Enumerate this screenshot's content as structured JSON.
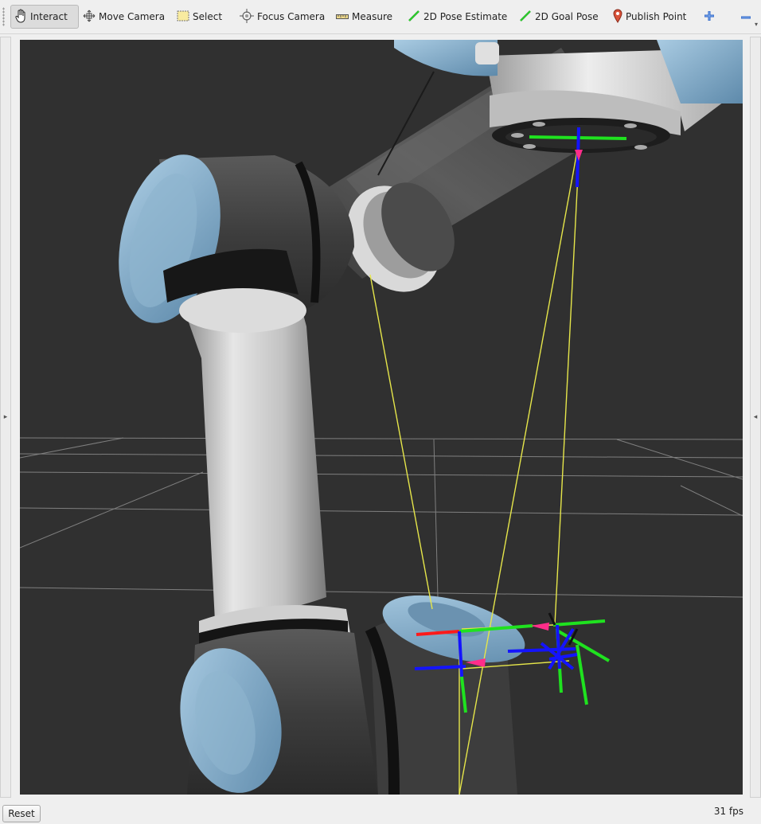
{
  "toolbar": {
    "tools": [
      {
        "label": "Interact",
        "icon": "hand-icon"
      },
      {
        "label": "Move Camera",
        "icon": "move-camera-icon"
      },
      {
        "label": "Select",
        "icon": "select-icon"
      },
      {
        "label": "Focus Camera",
        "icon": "focus-camera-icon"
      },
      {
        "label": "Measure",
        "icon": "ruler-icon"
      },
      {
        "label": "2D Pose Estimate",
        "icon": "green-arrow-icon"
      },
      {
        "label": "2D Goal Pose",
        "icon": "green-arrow-icon"
      },
      {
        "label": "Publish Point",
        "icon": "map-pin-icon"
      }
    ],
    "active_tool": "Interact"
  },
  "side_left_glyph": "▸",
  "side_right_glyph": "◂",
  "status": {
    "reset_label": "Reset",
    "fps": "31 fps"
  },
  "colors": {
    "viewport_bg": "#303030",
    "robot_blue": "#7aa6c6",
    "robot_dark": "#3e3e3e",
    "robot_light": "#c9c9c9",
    "axis_red": "#ff1a1a",
    "axis_green": "#1fe21f",
    "axis_blue": "#1414ff",
    "tf_line": "#e6e64a",
    "tf_arrow": "#ff2d8a"
  }
}
